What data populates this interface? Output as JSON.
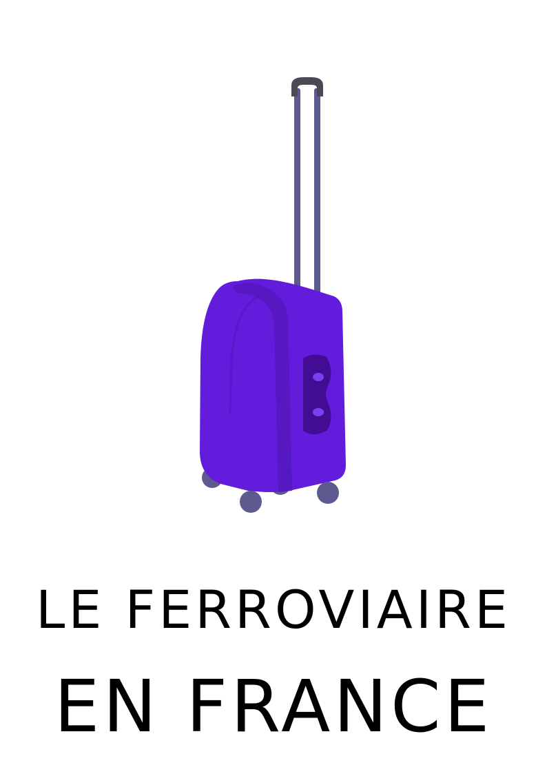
{
  "document": {
    "title_line_1": "LE FERROVIAIRE",
    "title_line_2": "EN FRANCE"
  },
  "illustration": {
    "icon": "suitcase-icon",
    "colors": {
      "body": "#631bdc",
      "body_shadow": "#5417bb",
      "handle_panel": "#420d93",
      "handle_holes": "#7c3ff0",
      "trolley_rods": "#5d5a8f",
      "trolley_grip": "#4a4a55",
      "wheels": "#5d5a8f"
    }
  }
}
